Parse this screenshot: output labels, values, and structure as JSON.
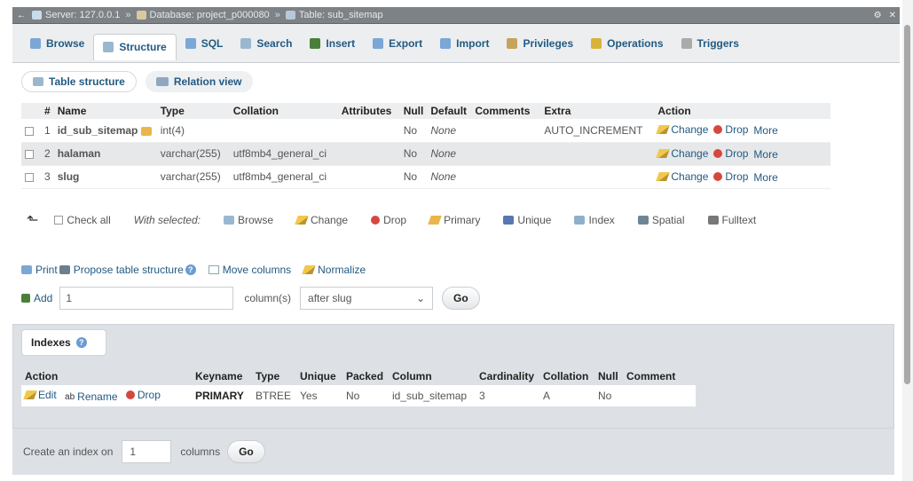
{
  "breadcrumb": {
    "server": "Server: 127.0.0.1",
    "database": "Database: project_p000080",
    "table": "Table: sub_sitemap"
  },
  "tabs": [
    {
      "label": "Browse",
      "icon": "browse-icon",
      "color": "#7aa7d6"
    },
    {
      "label": "Structure",
      "icon": "structure-icon",
      "color": "#9ab7d0"
    },
    {
      "label": "SQL",
      "icon": "sql-icon",
      "color": "#7aa7d6"
    },
    {
      "label": "Search",
      "icon": "search-icon",
      "color": "#9ab7d0"
    },
    {
      "label": "Insert",
      "icon": "insert-icon",
      "color": "#4a7f3a"
    },
    {
      "label": "Export",
      "icon": "export-icon",
      "color": "#7aa7d6"
    },
    {
      "label": "Import",
      "icon": "import-icon",
      "color": "#7aa7d6"
    },
    {
      "label": "Privileges",
      "icon": "privileges-icon",
      "color": "#c7a25a"
    },
    {
      "label": "Operations",
      "icon": "operations-icon",
      "color": "#d9b23a"
    },
    {
      "label": "Triggers",
      "icon": "triggers-icon",
      "color": "#aaaaaa"
    }
  ],
  "subtabs": {
    "table_structure": "Table structure",
    "relation_view": "Relation view"
  },
  "structure_headers": [
    "#",
    "Name",
    "Type",
    "Collation",
    "Attributes",
    "Null",
    "Default",
    "Comments",
    "Extra",
    "Action"
  ],
  "columns": [
    {
      "num": "1",
      "name": "id_sub_sitemap",
      "primary": true,
      "type": "int(4)",
      "collation": "",
      "attributes": "",
      "null": "No",
      "default": "None",
      "comments": "",
      "extra": "AUTO_INCREMENT"
    },
    {
      "num": "2",
      "name": "halaman",
      "primary": false,
      "type": "varchar(255)",
      "collation": "utf8mb4_general_ci",
      "attributes": "",
      "null": "No",
      "default": "None",
      "comments": "",
      "extra": ""
    },
    {
      "num": "3",
      "name": "slug",
      "primary": false,
      "type": "varchar(255)",
      "collation": "utf8mb4_general_ci",
      "attributes": "",
      "null": "No",
      "default": "None",
      "comments": "",
      "extra": ""
    }
  ],
  "row_actions": {
    "change": "Change",
    "drop": "Drop",
    "more": "More"
  },
  "with_selected": {
    "check_all": "Check all",
    "label": "With selected:",
    "browse": "Browse",
    "change": "Change",
    "drop": "Drop",
    "primary": "Primary",
    "unique": "Unique",
    "index": "Index",
    "spatial": "Spatial",
    "fulltext": "Fulltext"
  },
  "tools": {
    "print": "Print",
    "propose": "Propose table structure",
    "move_columns": "Move columns",
    "normalize": "Normalize"
  },
  "add_column": {
    "label": "Add",
    "count": "1",
    "unit": "column(s)",
    "position": "after slug",
    "go": "Go"
  },
  "indexes": {
    "legend": "Indexes",
    "headers": [
      "Action",
      "Keyname",
      "Type",
      "Unique",
      "Packed",
      "Column",
      "Cardinality",
      "Collation",
      "Null",
      "Comment"
    ],
    "rows": [
      {
        "edit": "Edit",
        "rename": "Rename",
        "drop": "Drop",
        "keyname": "PRIMARY",
        "type": "BTREE",
        "unique": "Yes",
        "packed": "No",
        "column": "id_sub_sitemap",
        "cardinality": "3",
        "collation": "A",
        "null": "No",
        "comment": ""
      }
    ],
    "create_label": "Create an index on",
    "create_count": "1",
    "create_unit": "columns",
    "go": "Go"
  }
}
